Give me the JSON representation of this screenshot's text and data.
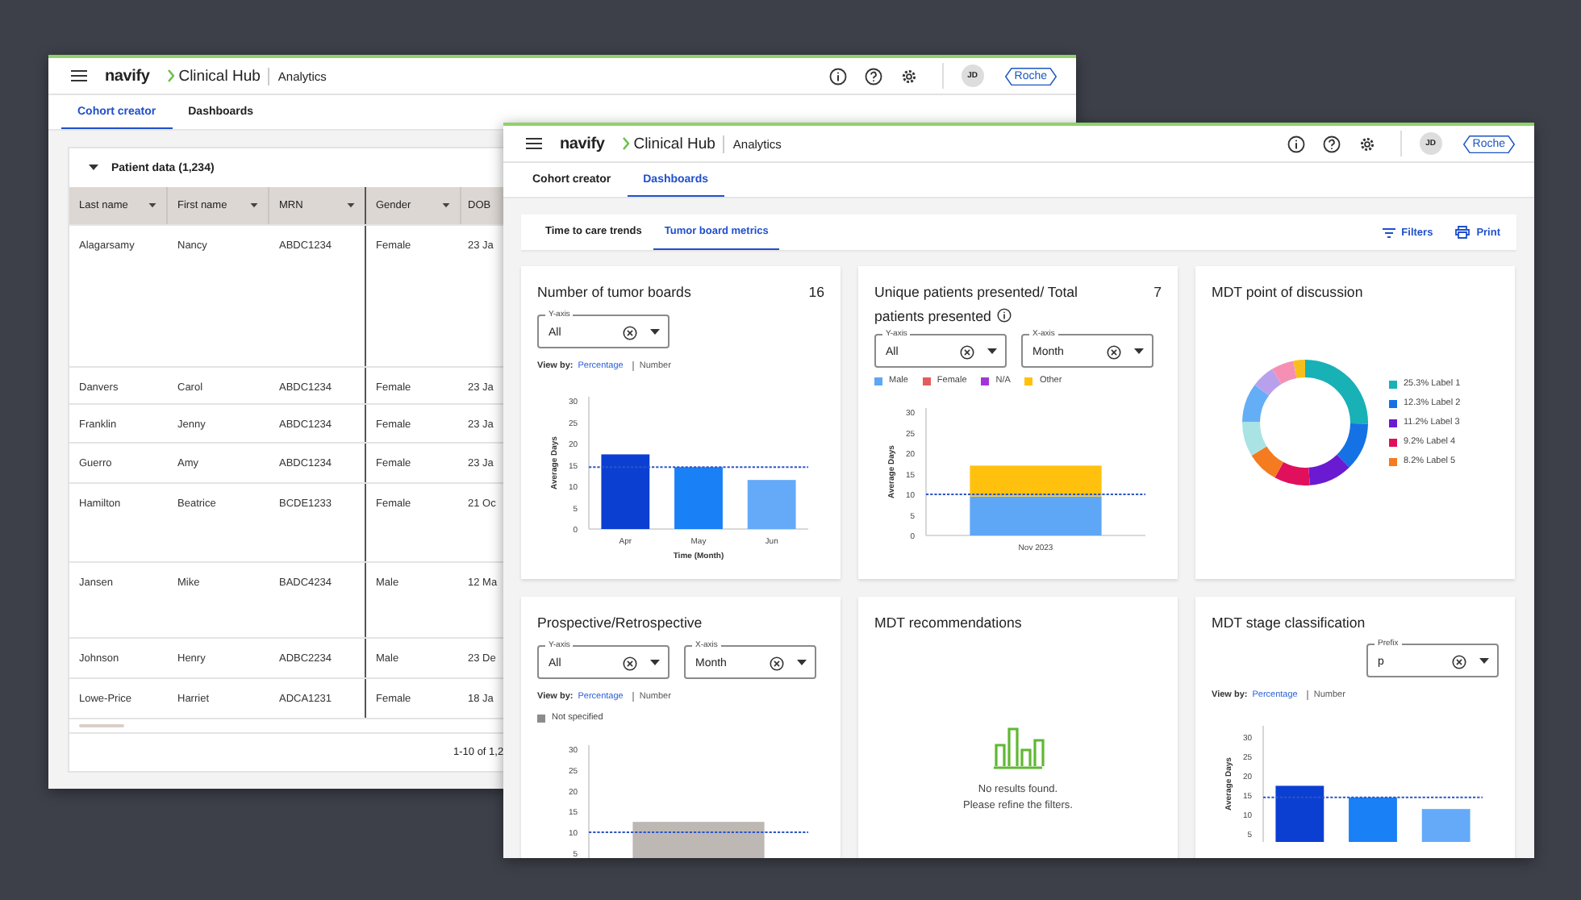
{
  "back_window": {
    "header": {
      "brand": "navify",
      "product": "Clinical Hub",
      "section": "Analytics",
      "avatar": "JD",
      "logo": "Roche"
    },
    "tabs": [
      {
        "label": "Cohort creator",
        "selected": true
      },
      {
        "label": "Dashboards",
        "selected": false
      }
    ],
    "panel": {
      "title": "Patient data (1,234)",
      "expanded": true
    },
    "table": {
      "columns": [
        {
          "label": "Last name",
          "menu": true
        },
        {
          "label": "First name",
          "menu": true
        },
        {
          "label": "MRN",
          "menu": true
        },
        {
          "label": "Gender",
          "menu": true
        },
        {
          "label": "DOB",
          "menu": false
        }
      ],
      "rows": [
        [
          "Alagarsamy",
          "Nancy",
          "ABDC1234",
          "Female",
          "23 Ja"
        ],
        [
          "Danvers",
          "Carol",
          "ABDC1234",
          "Female",
          "23 Ja"
        ],
        [
          "Franklin",
          "Jenny",
          "ABDC1234",
          "Female",
          "23 Ja"
        ],
        [
          "Guerro",
          "Amy",
          "ABDC1234",
          "Female",
          "23 Ja"
        ],
        [
          "Hamilton",
          "Beatrice",
          "BCDE1233",
          "Female",
          "21 Oc"
        ],
        [
          "Jansen",
          "Mike",
          "BADC4234",
          "Male",
          "12 Ma"
        ],
        [
          "Johnson",
          "Henry",
          "ADBC2234",
          "Male",
          "23 De"
        ],
        [
          "Lowe-Price",
          "Harriet",
          "ADCA1231",
          "Female",
          "18 Ja"
        ]
      ]
    },
    "pagination": "1-10 of 1,2"
  },
  "front_window": {
    "header": {
      "brand": "navify",
      "product": "Clinical Hub",
      "section": "Analytics",
      "avatar": "JD",
      "logo": "Roche"
    },
    "tabs": [
      {
        "label": "Cohort creator",
        "selected": false
      },
      {
        "label": "Dashboards",
        "selected": true
      }
    ],
    "subtabs": [
      {
        "label": "Time to care trends",
        "selected": false
      },
      {
        "label": "Tumor board metrics",
        "selected": true
      }
    ],
    "actions": [
      {
        "label": "Filters"
      },
      {
        "label": "Print"
      }
    ],
    "cards": [
      {
        "kind": "bar_chart",
        "title": "Number of tumor boards",
        "count": "16",
        "dropdowns": [
          {
            "label": "Y-axis",
            "value": "All"
          }
        ],
        "view_by": {
          "label": "View by:",
          "options": [
            {
              "label": "Percentage",
              "selected": true
            },
            {
              "label": "Number",
              "selected": false
            }
          ]
        },
        "chart_data": {
          "type": "bar",
          "ylabel": "Average Days",
          "xlabel": "Time (Month)",
          "categories": [
            "Apr",
            "May",
            "Jun"
          ],
          "series": [
            {
              "values": [
                17.5,
                14.5,
                11.5
              ],
              "colors": [
                "#0b3fd1",
                "#1a80f5",
                "#64aaf9"
              ]
            }
          ],
          "ylim": [
            0,
            31
          ],
          "yticks": [
            0,
            5,
            10,
            15,
            20,
            25,
            30
          ],
          "ref_lines": [
            {
              "axis": "y",
              "value": 14.5
            }
          ]
        }
      },
      {
        "kind": "bar_chart",
        "title": "Unique patients presented/ Total patients presented",
        "info": true,
        "count": "7",
        "dropdowns": [
          {
            "label": "Y-axis",
            "value": "All"
          },
          {
            "label": "X-axis",
            "value": "Month"
          }
        ],
        "chart_data": {
          "type": "bar",
          "stacked": true,
          "ylabel": "Average Days",
          "categories": [
            "Nov 2023"
          ],
          "series": [
            {
              "name": "Male",
              "color": "#5ea6f6",
              "values": [
                9.5
              ]
            },
            {
              "name": "Female",
              "color": "#e35d5d",
              "values": [
                0
              ]
            },
            {
              "name": "N/A",
              "color": "#a335d8",
              "values": [
                0
              ]
            },
            {
              "name": "Other",
              "color": "#ffc10e",
              "values": [
                7.5
              ]
            }
          ],
          "ylim": [
            0,
            31
          ],
          "yticks": [
            0,
            5,
            10,
            15,
            20,
            25,
            30
          ],
          "ref_lines": [
            {
              "axis": "y",
              "value": 10
            }
          ]
        }
      },
      {
        "kind": "donut",
        "title": "MDT point of discussion",
        "legend": [
          {
            "label": "25.3% Label 1",
            "color": "#17b1b6"
          },
          {
            "label": "12.3% Label 2",
            "color": "#1472e4"
          },
          {
            "label": "11.2% Label 3",
            "color": "#6a1bd1"
          },
          {
            "label": "9.2% Label 4",
            "color": "#e0105c"
          },
          {
            "label": "8.2% Label 5",
            "color": "#f57b20"
          }
        ],
        "chart_data": {
          "type": "donut",
          "values": [
            25.3,
            12.3,
            11.2,
            9.2,
            8.2,
            9,
            10,
            6,
            5.8,
            3
          ],
          "colors": [
            "#17b1b6",
            "#1472e4",
            "#6a1bd1",
            "#e0105c",
            "#f57b20",
            "#a9e3e3",
            "#64aef5",
            "#b9a0ec",
            "#f590b4",
            "#f8bf1c"
          ]
        }
      },
      {
        "kind": "bar_chart",
        "title": "Prospective/Retrospective",
        "dropdowns": [
          {
            "label": "Y-axis",
            "value": "All"
          },
          {
            "label": "X-axis",
            "value": "Month"
          }
        ],
        "view_by": {
          "label": "View by:",
          "options": [
            {
              "label": "Percentage",
              "selected": true
            },
            {
              "label": "Number",
              "selected": false
            }
          ]
        },
        "chart_data": {
          "type": "bar",
          "series": [
            {
              "name": "Not specified",
              "color": "#8c8c8c",
              "values": [
                12.5
              ],
              "colors": [
                "#bdb8b4"
              ]
            }
          ],
          "ylim": [
            3,
            31
          ],
          "yticks": [
            5,
            10,
            15,
            20,
            25,
            30
          ],
          "ref_lines": [
            {
              "axis": "y",
              "value": 10
            }
          ]
        }
      },
      {
        "kind": "empty",
        "title": "MDT recommendations",
        "message": [
          "No results found.",
          "Please refine the filters."
        ]
      },
      {
        "kind": "bar_chart",
        "title": "MDT stage classification",
        "dropdowns": [
          {
            "label": "Prefix",
            "value": "p"
          }
        ],
        "view_by": {
          "label": "View by:",
          "options": [
            {
              "label": "Percentage",
              "selected": true
            },
            {
              "label": "Number",
              "selected": false
            }
          ]
        },
        "chart_data": {
          "type": "bar",
          "ylabel": "Average Days",
          "series": [
            {
              "values": [
                17.5,
                14.5,
                11.5
              ],
              "colors": [
                "#0b3fd1",
                "#1a80f5",
                "#64aaf9"
              ]
            }
          ],
          "ylim": [
            3,
            33
          ],
          "yticks": [
            5,
            10,
            15,
            20,
            25,
            30
          ],
          "ref_lines": [
            {
              "axis": "y",
              "value": 14.5
            }
          ]
        }
      }
    ]
  }
}
